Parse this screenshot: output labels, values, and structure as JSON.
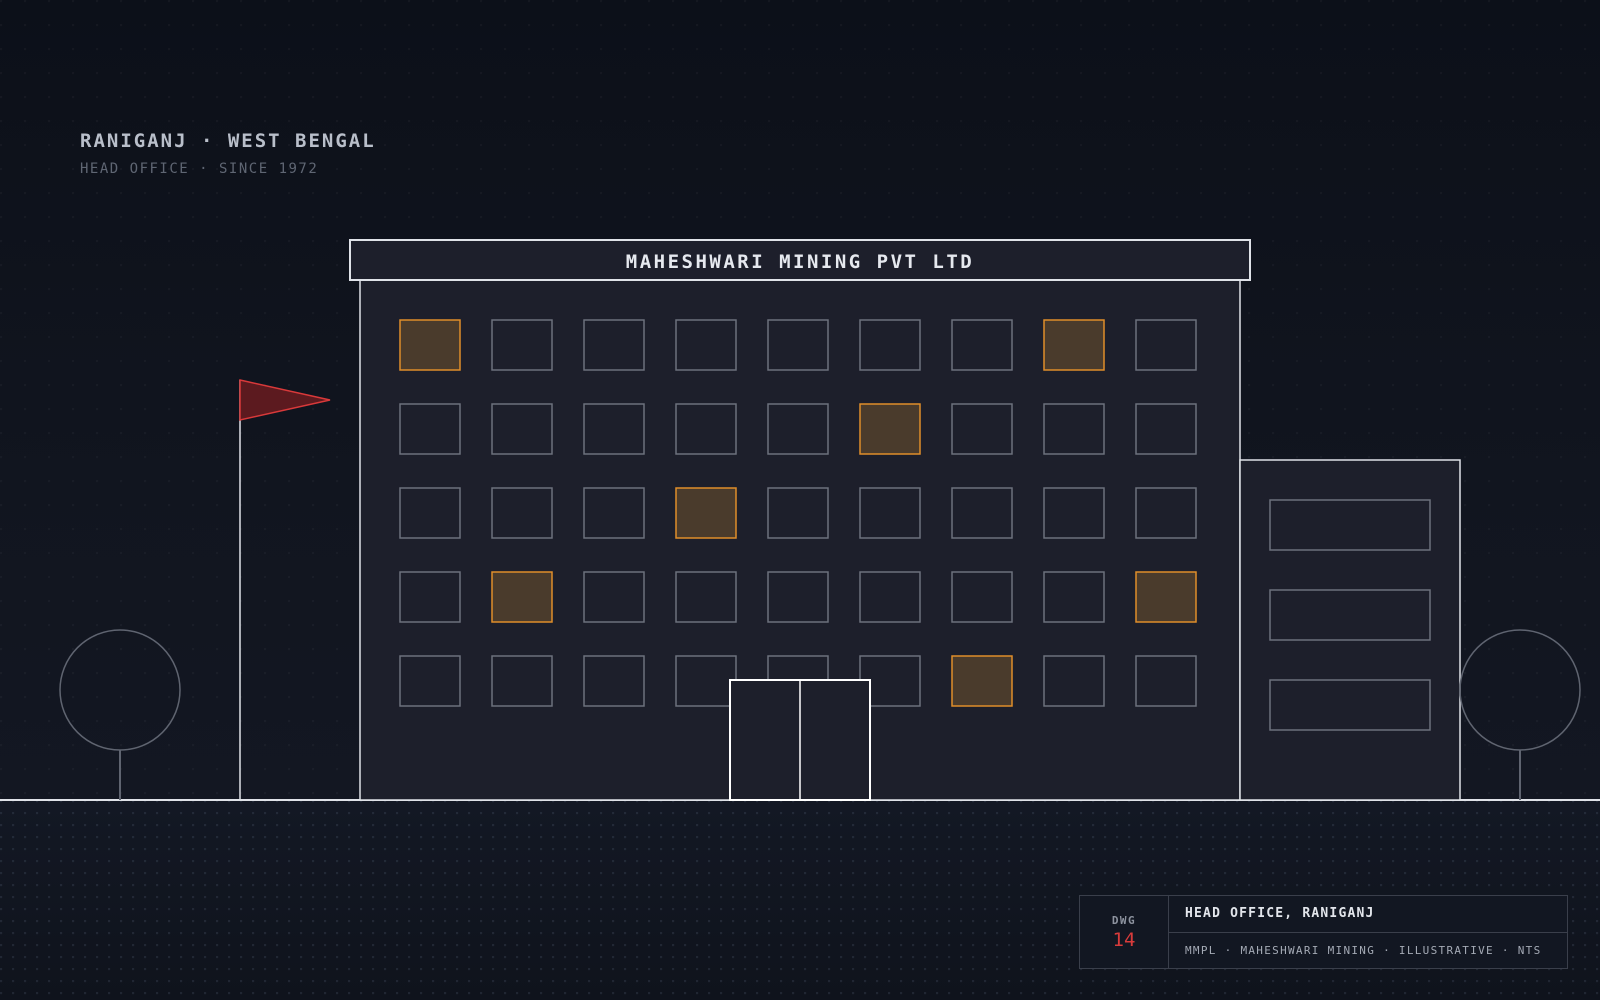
{
  "heading": {
    "location": "RANIGANJ · WEST BENGAL",
    "subtitle": "HEAD OFFICE · SINCE 1972"
  },
  "building": {
    "sign": "MAHESHWARI MINING PVT LTD",
    "window_grid": {
      "rows": 5,
      "cols": 9,
      "lit": [
        [
          0,
          0
        ],
        [
          0,
          7
        ],
        [
          1,
          5
        ],
        [
          2,
          3
        ],
        [
          3,
          1
        ],
        [
          3,
          8
        ],
        [
          4,
          6
        ]
      ]
    },
    "annex_windows": 3
  },
  "title_block": {
    "dwg_label": "DWG",
    "dwg_number": "14",
    "title": "HEAD OFFICE, RANIGANJ",
    "meta": "MMPL · MAHESHWARI MINING · ILLUSTRATIVE · NTS"
  },
  "colors": {
    "line": "#dfe2e8",
    "window_stroke": "#6c717c",
    "lit_fill": "#4a3b2c",
    "lit_stroke": "#e08e2a",
    "flag": "#d9393a",
    "dwg_number": "#d83b3b"
  }
}
